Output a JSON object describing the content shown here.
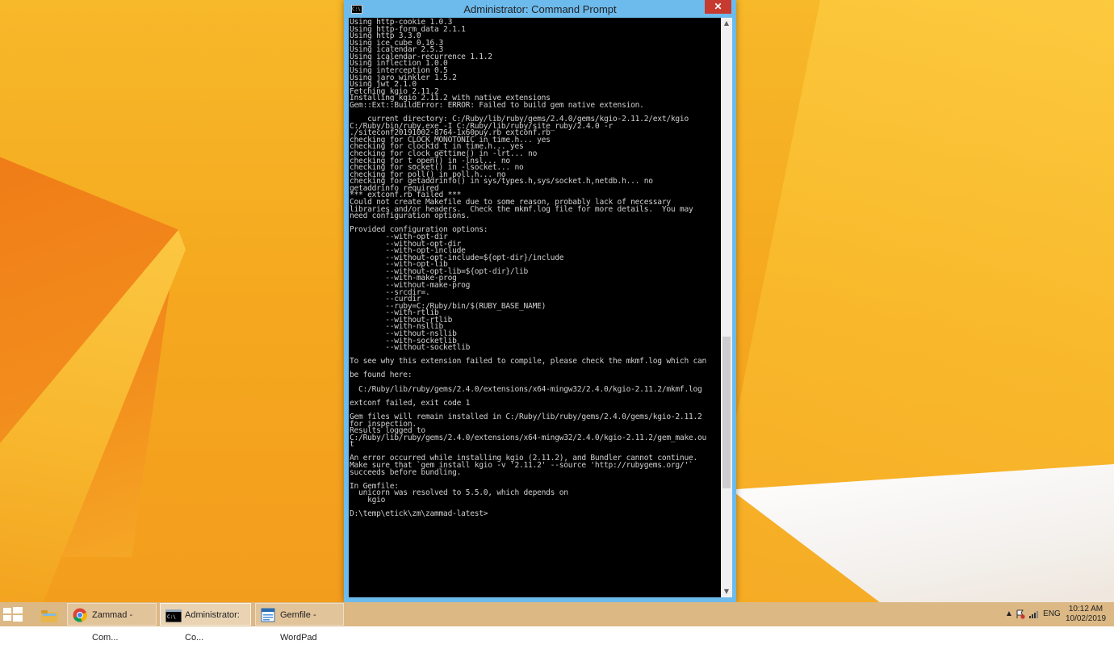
{
  "window": {
    "title": "Administrator: Command Prompt",
    "icon_label": "C:\\",
    "buttons": {
      "minimize": "–",
      "maximize": "□",
      "close": "✕"
    }
  },
  "console": {
    "lines": [
      "Using http-cookie 1.0.3",
      "Using http-form_data 2.1.1",
      "Using http 3.3.0",
      "Using ice_cube 0.16.3",
      "Using icalendar 2.5.3",
      "Using icalendar-recurrence 1.1.2",
      "Using inflection 1.0.0",
      "Using interception 0.5",
      "Using jaro_winkler 1.5.2",
      "Using jwt 2.1.0",
      "Fetching kgio 2.11.2",
      "Installing kgio 2.11.2 with native extensions",
      "Gem::Ext::BuildError: ERROR: Failed to build gem native extension.",
      "",
      "    current directory: C:/Ruby/lib/ruby/gems/2.4.0/gems/kgio-2.11.2/ext/kgio",
      "C:/Ruby/bin/ruby.exe -I C:/Ruby/lib/ruby/site_ruby/2.4.0 -r",
      "./siteconf20191002-8764-1x60puy.rb extconf.rb",
      "checking for CLOCK_MONOTONIC in time.h... yes",
      "checking for clockid_t in time.h... yes",
      "checking for clock_gettime() in -lrt... no",
      "checking for t_open() in -lnsl... no",
      "checking for socket() in -lsocket... no",
      "checking for poll() in poll.h... no",
      "checking for getaddrinfo() in sys/types.h,sys/socket.h,netdb.h... no",
      "getaddrinfo required",
      "*** extconf.rb failed ***",
      "Could not create Makefile due to some reason, probably lack of necessary",
      "libraries and/or headers.  Check the mkmf.log file for more details.  You may",
      "need configuration options.",
      "",
      "Provided configuration options:",
      "        --with-opt-dir",
      "        --without-opt-dir",
      "        --with-opt-include",
      "        --without-opt-include=${opt-dir}/include",
      "        --with-opt-lib",
      "        --without-opt-lib=${opt-dir}/lib",
      "        --with-make-prog",
      "        --without-make-prog",
      "        --srcdir=.",
      "        --curdir",
      "        --ruby=C:/Ruby/bin/$(RUBY_BASE_NAME)",
      "        --with-rtlib",
      "        --without-rtlib",
      "        --with-nsllib",
      "        --without-nsllib",
      "        --with-socketlib",
      "        --without-socketlib",
      "",
      "To see why this extension failed to compile, please check the mkmf.log which can",
      "",
      "be found here:",
      "",
      "  C:/Ruby/lib/ruby/gems/2.4.0/extensions/x64-mingw32/2.4.0/kgio-2.11.2/mkmf.log",
      "",
      "extconf failed, exit code 1",
      "",
      "Gem files will remain installed in C:/Ruby/lib/ruby/gems/2.4.0/gems/kgio-2.11.2",
      "for inspection.",
      "Results logged to",
      "C:/Ruby/lib/ruby/gems/2.4.0/extensions/x64-mingw32/2.4.0/kgio-2.11.2/gem_make.ou",
      "t",
      "",
      "An error occurred while installing kgio (2.11.2), and Bundler cannot continue.",
      "Make sure that `gem install kgio -v '2.11.2' --source 'http://rubygems.org/'`",
      "succeeds before bundling.",
      "",
      "In Gemfile:",
      "  unicorn was resolved to 5.5.0, which depends on",
      "    kgio",
      "",
      "D:\\temp\\etick\\zm\\zammad-latest>"
    ]
  },
  "taskbar": {
    "items": [
      {
        "label": "Zammad - Com..."
      },
      {
        "label": "Administrator: Co..."
      },
      {
        "label": "Gemfile - WordPad"
      }
    ],
    "tray": {
      "language": "ENG"
    },
    "clock": {
      "time": "10:12 AM",
      "date": "10/02/2019"
    }
  },
  "colors": {
    "desktop_accent": "#f7b82a",
    "title_active": "#6dbbed",
    "close_button": "#c73a30",
    "console_bg": "#000000",
    "console_fg": "#cfcfcf"
  }
}
